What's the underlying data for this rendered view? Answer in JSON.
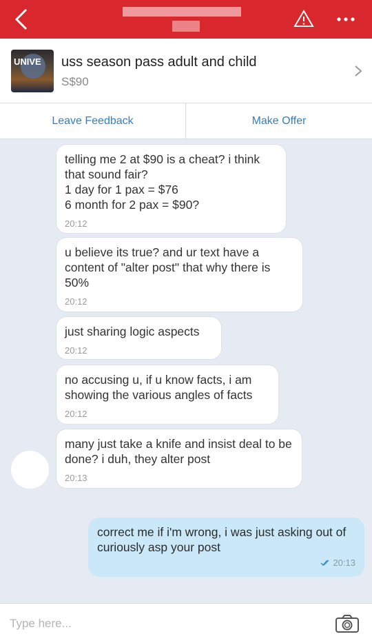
{
  "header": {
    "back_icon": "chevron-left-icon",
    "alert_icon": "warning-triangle-icon",
    "more_icon": "more-dots-icon",
    "accent": "#d9272e"
  },
  "listing": {
    "thumb_text": "UNIVE",
    "title": "uss season pass adult and child",
    "price": "S$90"
  },
  "actions": {
    "leave_feedback": "Leave Feedback",
    "make_offer": "Make Offer"
  },
  "messages": [
    {
      "text": "telling me 2 at $90 is a cheat? i think that sound fair?\n1 day for 1 pax = $76\n6 month for 2 pax = $90?",
      "time": "20:12"
    },
    {
      "text": "u believe its true? and ur text have a content of \"alter post\" that why there is 50%",
      "time": "20:12"
    },
    {
      "text": "just sharing logic aspects",
      "time": "20:12"
    },
    {
      "text": "no accusing u, if u know facts, i am showing the various angles of facts",
      "time": "20:12"
    },
    {
      "text": "many just take a knife and insist deal to be done? i duh, they alter post",
      "time": "20:13"
    }
  ],
  "outgoing": {
    "text": "correct me if i'm wrong, i was just asking out of curiously asp your post",
    "time": "20:13"
  },
  "composer": {
    "placeholder": "Type here...",
    "camera_icon": "camera-icon"
  }
}
